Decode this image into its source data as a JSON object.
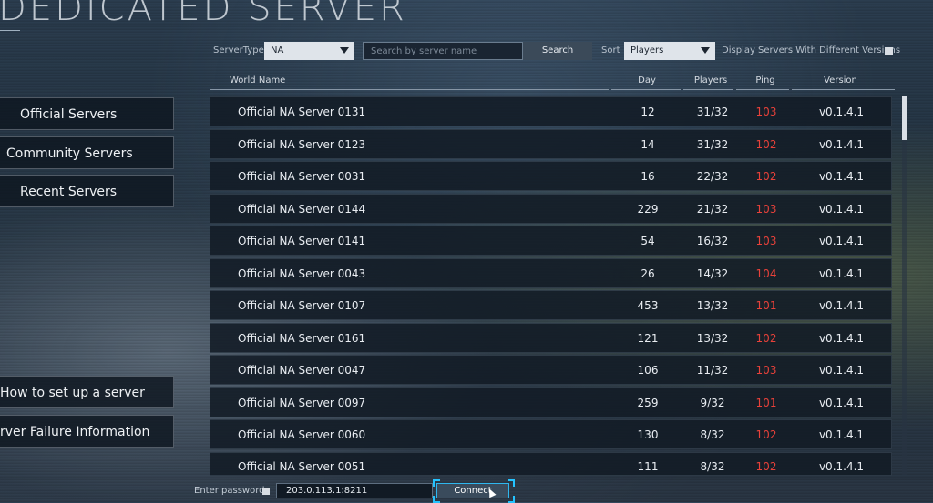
{
  "page_title": "DEDICATED SERVER",
  "filters": {
    "server_type_label": "ServerType",
    "server_type_value": "NA",
    "search_placeholder": "Search by server name",
    "search_button": "Search",
    "sort_label": "Sort",
    "sort_value": "Players",
    "different_versions_label": "Display Servers With Different Versions"
  },
  "table": {
    "headers": {
      "world_name": "World Name",
      "day": "Day",
      "players": "Players",
      "ping": "Ping",
      "version": "Version"
    },
    "rows": [
      {
        "name": "Official NA Server 0131",
        "day": "12",
        "players": "31/32",
        "ping": "103",
        "version": "v0.1.4.1"
      },
      {
        "name": "Official NA Server 0123",
        "day": "14",
        "players": "31/32",
        "ping": "102",
        "version": "v0.1.4.1"
      },
      {
        "name": "Official NA Server 0031",
        "day": "16",
        "players": "22/32",
        "ping": "102",
        "version": "v0.1.4.1"
      },
      {
        "name": "Official NA Server 0144",
        "day": "229",
        "players": "21/32",
        "ping": "103",
        "version": "v0.1.4.1"
      },
      {
        "name": "Official NA Server 0141",
        "day": "54",
        "players": "16/32",
        "ping": "103",
        "version": "v0.1.4.1"
      },
      {
        "name": "Official NA Server 0043",
        "day": "26",
        "players": "14/32",
        "ping": "104",
        "version": "v0.1.4.1"
      },
      {
        "name": "Official NA Server 0107",
        "day": "453",
        "players": "13/32",
        "ping": "101",
        "version": "v0.1.4.1"
      },
      {
        "name": "Official NA Server 0161",
        "day": "121",
        "players": "13/32",
        "ping": "102",
        "version": "v0.1.4.1"
      },
      {
        "name": "Official NA Server 0047",
        "day": "106",
        "players": "11/32",
        "ping": "103",
        "version": "v0.1.4.1"
      },
      {
        "name": "Official NA Server 0097",
        "day": "259",
        "players": "9/32",
        "ping": "101",
        "version": "v0.1.4.1"
      },
      {
        "name": "Official NA Server 0060",
        "day": "130",
        "players": "8/32",
        "ping": "102",
        "version": "v0.1.4.1"
      },
      {
        "name": "Official NA Server 0051",
        "day": "111",
        "players": "8/32",
        "ping": "102",
        "version": "v0.1.4.1"
      }
    ]
  },
  "sidebar": {
    "items": [
      {
        "label": "Official Servers"
      },
      {
        "label": "Community Servers"
      },
      {
        "label": "Recent Servers"
      },
      {
        "label": "How to set up a server"
      },
      {
        "label": "rver Failure Information"
      }
    ]
  },
  "footer": {
    "password_label": "Enter password",
    "address_value": "203.0.113.1:8211",
    "connect_button": "Connect"
  },
  "colors": {
    "ping": "#e8413a",
    "accent": "#2fb7ef"
  }
}
